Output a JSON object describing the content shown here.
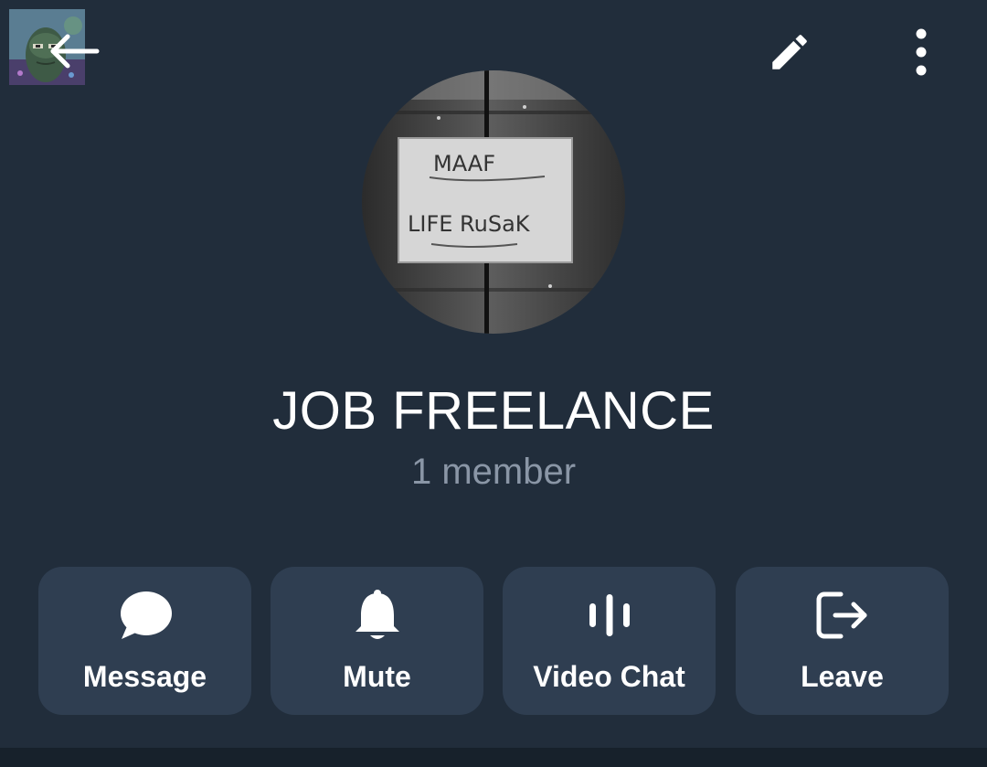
{
  "header": {
    "back_icon": "arrow-left-icon",
    "edit_icon": "pencil-icon",
    "more_icon": "more-vertical-icon"
  },
  "avatar": {
    "photo_text_line1": "MAAF",
    "photo_text_line2": "LIFE RuSaK"
  },
  "group": {
    "title": "JOB FREELANCE",
    "subtitle": "1 member"
  },
  "actions": [
    {
      "label": "Message",
      "icon": "chat-bubble-icon"
    },
    {
      "label": "Mute",
      "icon": "bell-icon"
    },
    {
      "label": "Video Chat",
      "icon": "voice-chat-icon"
    },
    {
      "label": "Leave",
      "icon": "leave-icon"
    }
  ],
  "colors": {
    "background": "#212d3b",
    "button_bg": "#2f3e51",
    "subtitle": "#8a96a6",
    "text": "#ffffff"
  }
}
